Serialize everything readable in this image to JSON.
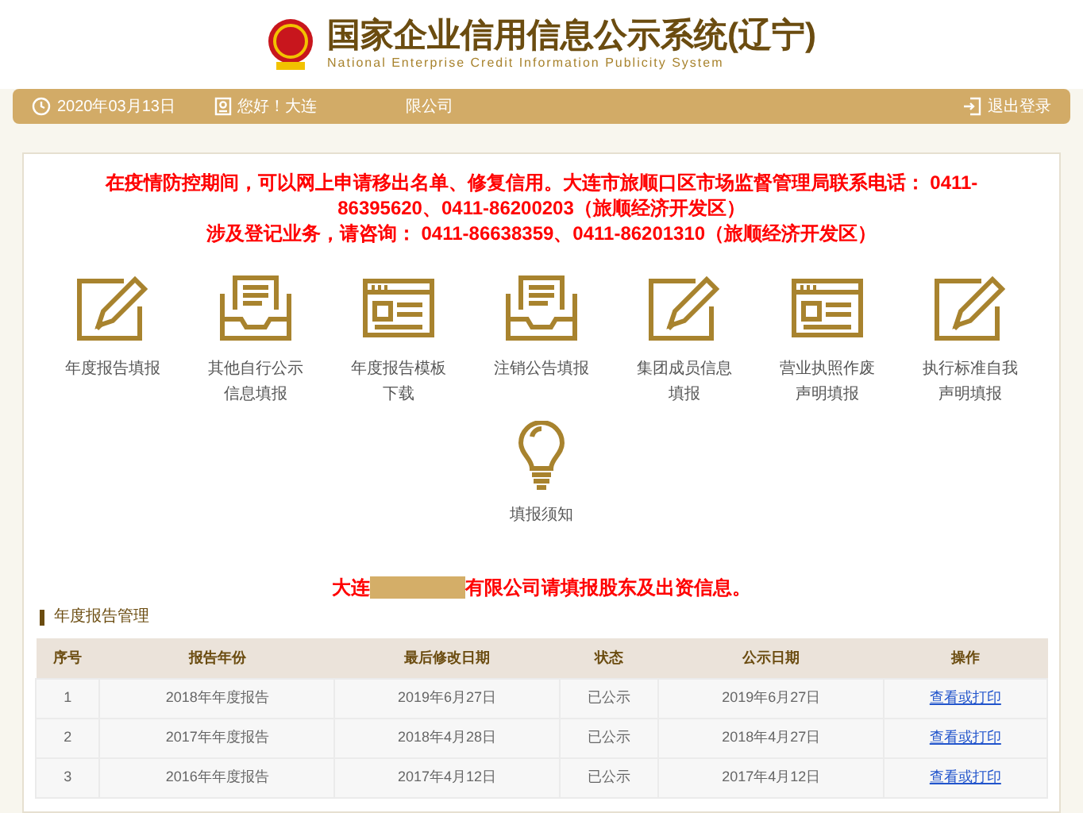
{
  "header": {
    "title": "国家企业信用信息公示系统(辽宁)",
    "subtitle": "National Enterprise Credit Information Publicity System"
  },
  "top_bar": {
    "date": "2020年03月13日",
    "greeting": "您好！大连",
    "company": "限公司",
    "logout": "退出登录"
  },
  "notice": [
    "在疫情防控期间，可以网上申请移出名单、修复信用。大连市旅顺口区市场监督管理局联系电话： 0411-86395620、0411-86200203（旅顺经济开发区）",
    "涉及登记业务，请咨询： 0411-86638359、0411-86201310（旅顺经济开发区）"
  ],
  "actions": [
    {
      "kind": "edit",
      "label": "年度报告填报"
    },
    {
      "kind": "tray",
      "label": "其他自行公示信息填报"
    },
    {
      "kind": "window",
      "label": "年度报告模板下载"
    },
    {
      "kind": "tray",
      "label": "注销公告填报"
    },
    {
      "kind": "edit",
      "label": "集团成员信息填报"
    },
    {
      "kind": "window",
      "label": "营业执照作废声明填报"
    },
    {
      "kind": "edit",
      "label": "执行标准自我声明填报"
    },
    {
      "kind": "bulb",
      "label": "填报须知"
    }
  ],
  "reminder": {
    "before": "大连",
    "after": "有限公司请填报股东及出资信息。"
  },
  "section_title": "年度报告管理",
  "table": {
    "columns": [
      "序号",
      "报告年份",
      "最后修改日期",
      "状态",
      "公示日期",
      "操作"
    ],
    "rows": [
      [
        "1",
        "2018年年度报告",
        "2019年6月27日",
        "已公示",
        "2019年6月27日",
        "查看或打印"
      ],
      [
        "2",
        "2017年年度报告",
        "2018年4月28日",
        "已公示",
        "2018年4月27日",
        "查看或打印"
      ],
      [
        "3",
        "2016年年度报告",
        "2017年4月12日",
        "已公示",
        "2017年4月12日",
        "查看或打印"
      ]
    ]
  }
}
